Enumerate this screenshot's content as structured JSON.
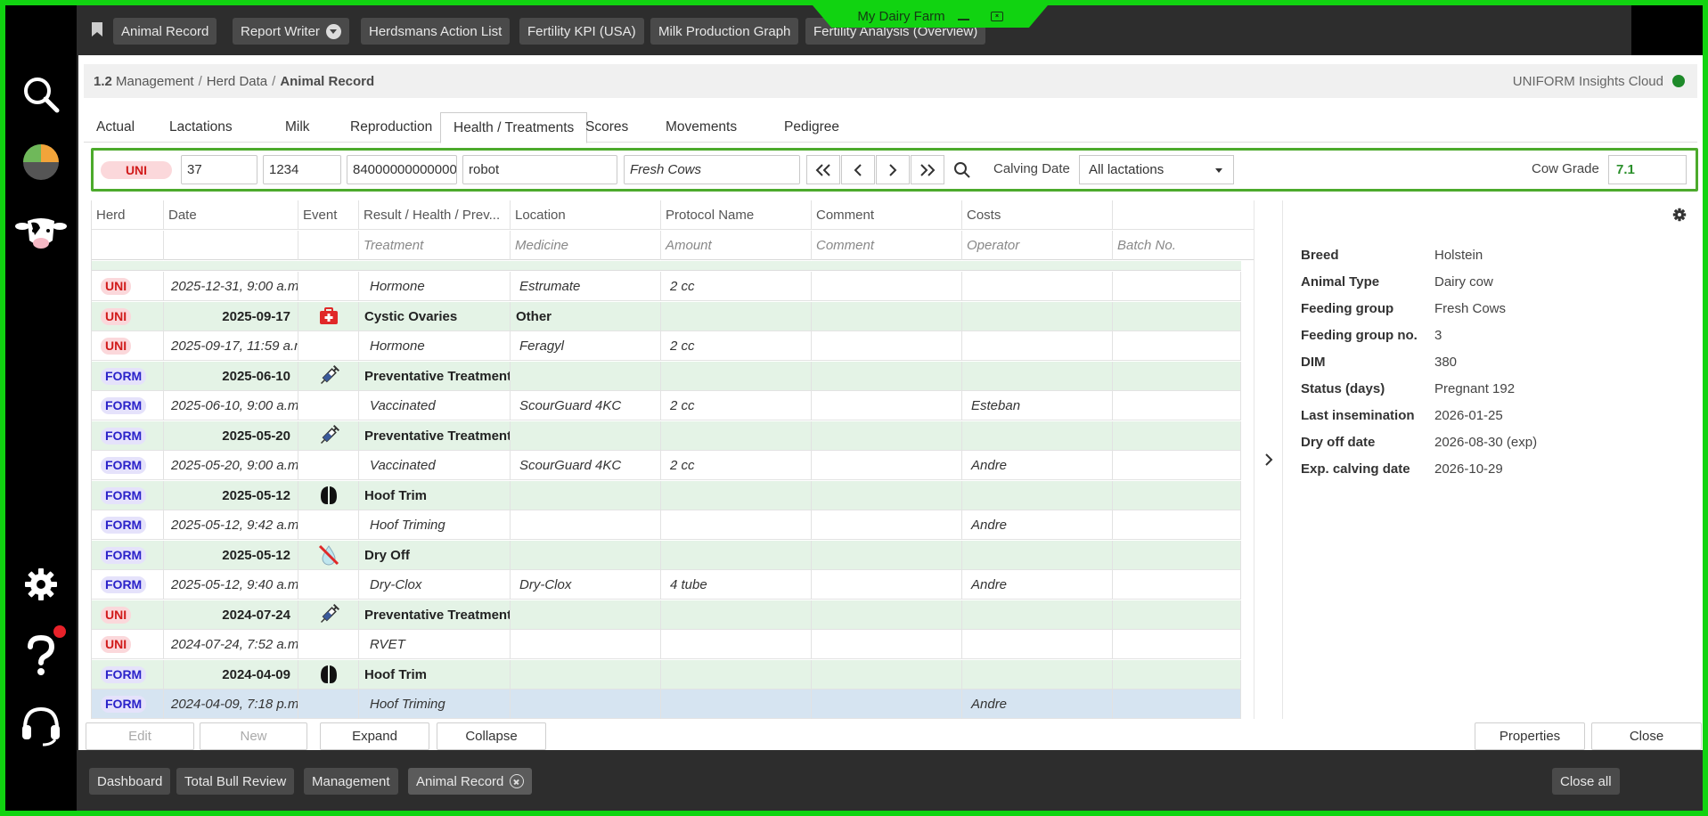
{
  "window": {
    "title": "My Dairy Farm"
  },
  "quick_tabs": [
    "Animal Record",
    "Report Writer",
    "Herdsmans Action List",
    "Fertility KPI (USA)",
    "Milk Production Graph",
    "Fertility Analysis (Overview)"
  ],
  "breadcrumb": {
    "number": "1.2",
    "part1": "Management",
    "part2": "Herd Data",
    "current": "Animal Record"
  },
  "cloud_label": "UNIFORM Insights Cloud",
  "tabs": [
    "Actual",
    "Lactations",
    "Milk",
    "Reproduction",
    "Health / Treatments",
    "Scores",
    "Movements",
    "Pedigree"
  ],
  "active_tab": "Health / Treatments",
  "filter": {
    "herd": "UNI",
    "animal_no": "37",
    "id": "1234",
    "eid": "84000000000000",
    "name": "robot",
    "group": "Fresh Cows",
    "calving_label": "Calving Date",
    "lactation": "All lactations",
    "grade_label": "Cow Grade",
    "grade": "7.1"
  },
  "columns": {
    "row1": [
      "Herd",
      "Date",
      "Event",
      "Result / Health / Prev...",
      "Location",
      "Protocol Name",
      "Comment",
      "Costs",
      ""
    ],
    "row2": [
      "",
      "",
      "",
      "Treatment",
      "Medicine",
      "Amount",
      "Comment",
      "Operator",
      "Batch No."
    ]
  },
  "rows": [
    {
      "kind": "tr",
      "herd": "UNI",
      "date": "2025-12-31, 9:00 a.m.",
      "icon": "",
      "c1": "Hormone",
      "c2": "Estrumate",
      "c3": "2 cc",
      "c4": "",
      "c5": "",
      "c6": ""
    },
    {
      "kind": "ev",
      "herd": "UNI",
      "date": "2025-09-17",
      "icon": "medkit",
      "c1": "Cystic Ovaries",
      "c2": "Other",
      "c3": "",
      "c4": "",
      "c5": "",
      "c6": ""
    },
    {
      "kind": "tr",
      "herd": "UNI",
      "date": "2025-09-17, 11:59 a.m.",
      "icon": "",
      "c1": "Hormone",
      "c2": "Feragyl",
      "c3": "2 cc",
      "c4": "",
      "c5": "",
      "c6": ""
    },
    {
      "kind": "ev",
      "herd": "FORM",
      "date": "2025-06-10",
      "icon": "syringe",
      "c1": "Preventative Treatment",
      "c2": "",
      "c3": "",
      "c4": "",
      "c5": "",
      "c6": ""
    },
    {
      "kind": "tr",
      "herd": "FORM",
      "date": "2025-06-10, 9:00 a.m.",
      "icon": "",
      "c1": "Vaccinated",
      "c2": "ScourGuard 4KC",
      "c3": "2 cc",
      "c4": "",
      "c5": "Esteban",
      "c6": ""
    },
    {
      "kind": "ev",
      "herd": "FORM",
      "date": "2025-05-20",
      "icon": "syringe",
      "c1": "Preventative Treatment",
      "c2": "",
      "c3": "",
      "c4": "",
      "c5": "",
      "c6": ""
    },
    {
      "kind": "tr",
      "herd": "FORM",
      "date": "2025-05-20, 9:00 a.m.",
      "icon": "",
      "c1": "Vaccinated",
      "c2": "ScourGuard 4KC",
      "c3": "2 cc",
      "c4": "",
      "c5": "Andre",
      "c6": ""
    },
    {
      "kind": "ev",
      "herd": "FORM",
      "date": "2025-05-12",
      "icon": "hoof",
      "c1": "Hoof Trim",
      "c2": "",
      "c3": "",
      "c4": "",
      "c5": "",
      "c6": ""
    },
    {
      "kind": "tr",
      "herd": "FORM",
      "date": "2025-05-12, 9:42 a.m.",
      "icon": "",
      "c1": "Hoof Triming",
      "c2": "",
      "c3": "",
      "c4": "",
      "c5": "Andre",
      "c6": ""
    },
    {
      "kind": "ev",
      "herd": "FORM",
      "date": "2025-05-12",
      "icon": "dryoff",
      "c1": "Dry Off",
      "c2": "",
      "c3": "",
      "c4": "",
      "c5": "",
      "c6": ""
    },
    {
      "kind": "tr",
      "herd": "FORM",
      "date": "2025-05-12, 9:40 a.m.",
      "icon": "",
      "c1": "Dry-Clox",
      "c2": "Dry-Clox",
      "c3": "4 tube",
      "c4": "",
      "c5": "Andre",
      "c6": ""
    },
    {
      "kind": "ev",
      "herd": "UNI",
      "date": "2024-07-24",
      "icon": "syringe",
      "c1": "Preventative Treatment",
      "c2": "",
      "c3": "",
      "c4": "",
      "c5": "",
      "c6": ""
    },
    {
      "kind": "tr",
      "herd": "UNI",
      "date": "2024-07-24, 7:52 a.m.",
      "icon": "",
      "c1": "RVET",
      "c2": "",
      "c3": "",
      "c4": "",
      "c5": "",
      "c6": ""
    },
    {
      "kind": "ev",
      "herd": "FORM",
      "date": "2024-04-09",
      "icon": "hoof",
      "c1": "Hoof Trim",
      "c2": "",
      "c3": "",
      "c4": "",
      "c5": "",
      "c6": ""
    },
    {
      "kind": "tr sel",
      "herd": "FORM",
      "date": "2024-04-09, 7:18 p.m.",
      "icon": "",
      "c1": "Hoof Triming",
      "c2": "",
      "c3": "",
      "c4": "",
      "c5": "Andre",
      "c6": ""
    }
  ],
  "properties": [
    {
      "k": "Breed",
      "v": "Holstein"
    },
    {
      "k": "Animal Type",
      "v": "Dairy cow"
    },
    {
      "k": "Feeding group",
      "v": "Fresh Cows"
    },
    {
      "k": "Feeding group no.",
      "v": "3"
    },
    {
      "k": "DIM",
      "v": "380"
    },
    {
      "k": "Status (days)",
      "v": "Pregnant 192"
    },
    {
      "k": "Last insemination",
      "v": "2026-01-25"
    },
    {
      "k": "Dry off date",
      "v": "2026-08-30 (exp)"
    },
    {
      "k": "Exp. calving date",
      "v": "2026-10-29"
    }
  ],
  "buttons": {
    "edit": "Edit",
    "new": "New",
    "expand": "Expand",
    "collapse": "Collapse",
    "properties": "Properties",
    "close": "Close"
  },
  "footer_tabs": [
    "Dashboard",
    "Total Bull Review",
    "Management",
    "Animal Record"
  ],
  "footer_close_all": "Close all",
  "colors": {
    "accent_green": "#11d311",
    "event_row": "#e4f3e6",
    "selected_row": "#d6e4f1",
    "uni": "#d11b1b",
    "form": "#2a22c9"
  }
}
